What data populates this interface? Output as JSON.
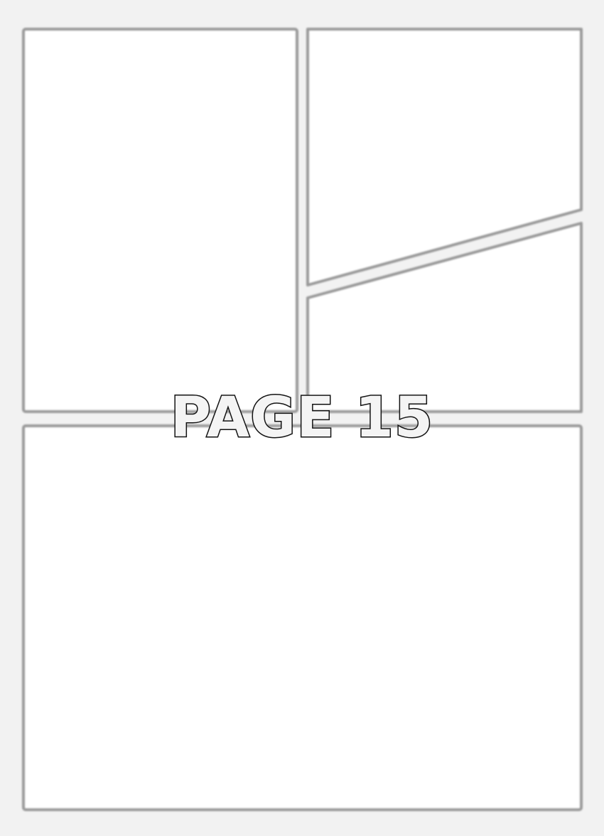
{
  "page": {
    "label": "PAGE 15"
  },
  "colors": {
    "background": "#f2f2f2",
    "panel_fill": "#ffffff",
    "panel_border": "#9a9a9a",
    "label_fill": "#f4f4f4",
    "label_outline": "#111111"
  }
}
